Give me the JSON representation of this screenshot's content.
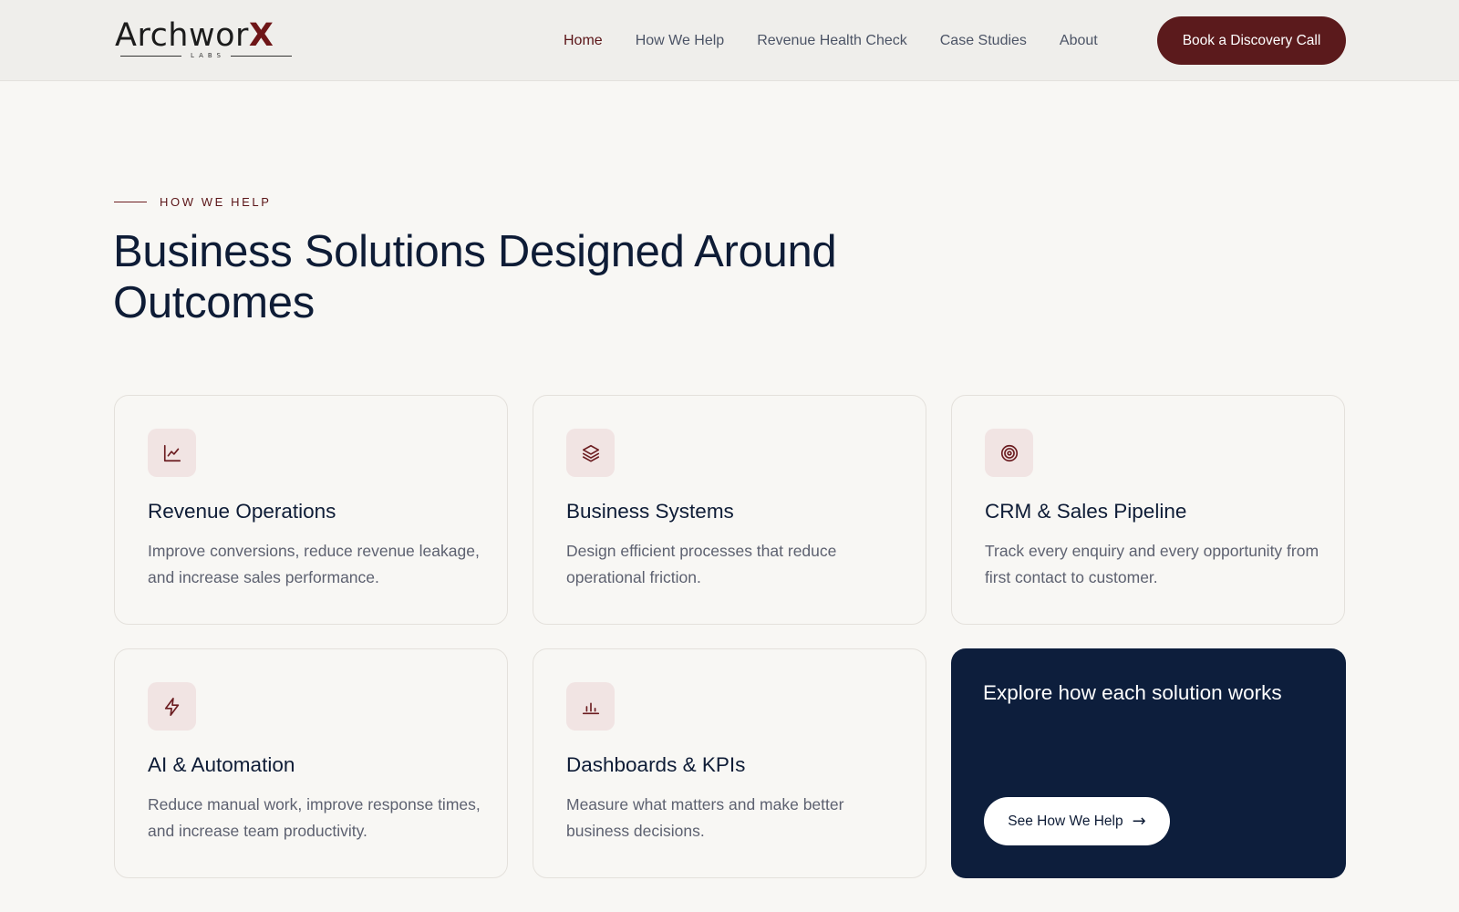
{
  "brand": {
    "logo_main": "Archwor",
    "logo_accent": "X",
    "logo_sub": "LABS"
  },
  "nav": {
    "items": [
      {
        "label": "Home",
        "active": true
      },
      {
        "label": "How We Help",
        "active": false
      },
      {
        "label": "Revenue Health Check",
        "active": false
      },
      {
        "label": "Case Studies",
        "active": false
      },
      {
        "label": "About",
        "active": false
      }
    ],
    "cta_label": "Book a Discovery Call"
  },
  "section": {
    "eyebrow": "HOW WE HELP",
    "title": "Business Solutions Designed Around Outcomes"
  },
  "cards": [
    {
      "icon": "line-chart-icon",
      "title": "Revenue Operations",
      "description": "Improve conversions, reduce revenue leakage, and increase sales performance."
    },
    {
      "icon": "layers-icon",
      "title": "Business Systems",
      "description": "Design efficient processes that reduce operational friction."
    },
    {
      "icon": "target-icon",
      "title": "CRM & Sales Pipeline",
      "description": "Track every enquiry and every opportunity from first contact to customer."
    },
    {
      "icon": "lightning-icon",
      "title": "AI & Automation",
      "description": "Reduce manual work, improve response times, and increase team productivity."
    },
    {
      "icon": "bar-chart-icon",
      "title": "Dashboards & KPIs",
      "description": "Measure what matters and make better business decisions."
    }
  ],
  "promo": {
    "title": "Explore how each solution works",
    "button_label": "See How We Help",
    "button_arrow": "→"
  },
  "colors": {
    "background": "#f8f7f4",
    "header": "#efeeeb",
    "accent": "#5b1a1c",
    "navy": "#0d1e3c",
    "icon_bg": "#f1e4e3"
  }
}
